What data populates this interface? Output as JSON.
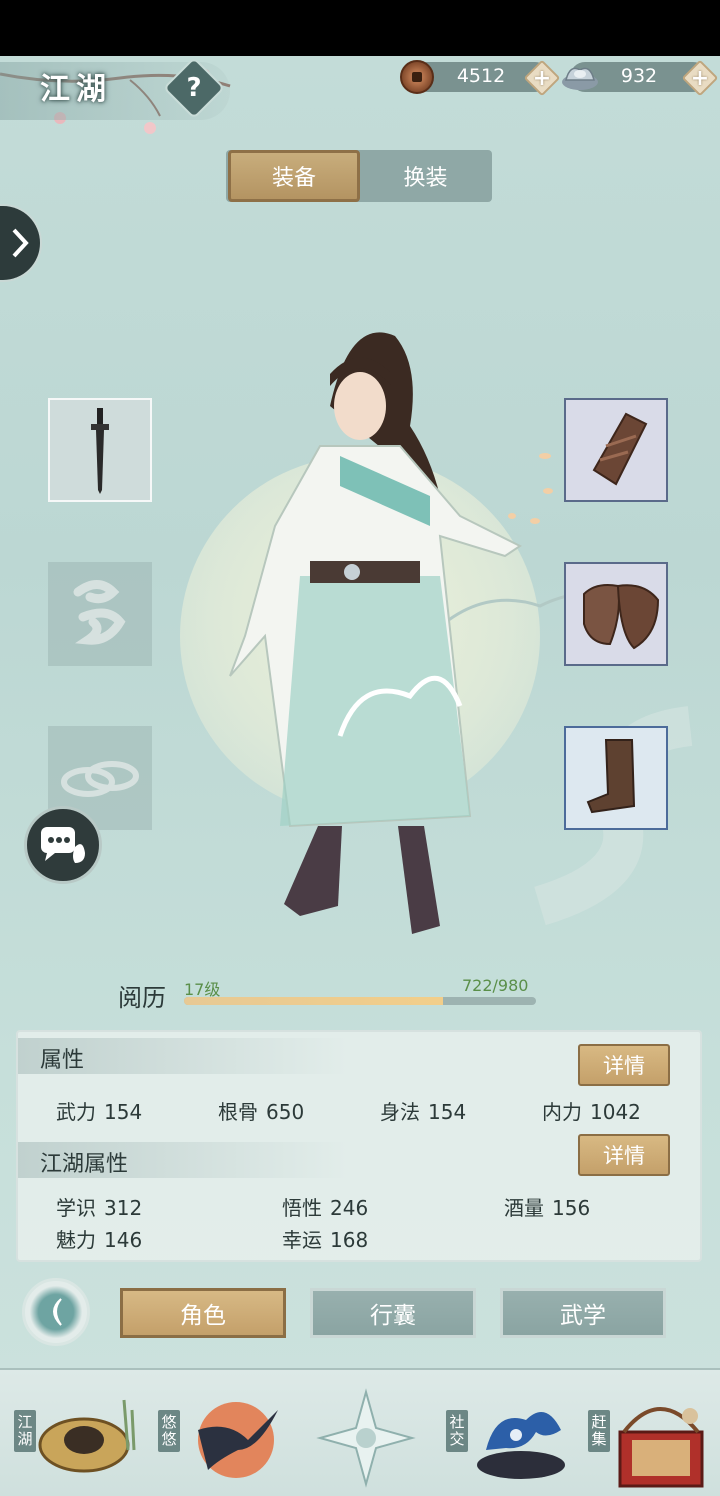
{
  "header": {
    "title": "江湖",
    "help_label": "?",
    "copper": "4512",
    "silver": "932",
    "plus_label": "+"
  },
  "tabs": [
    {
      "label": "装备",
      "active": true
    },
    {
      "label": "换装",
      "active": false
    }
  ],
  "experience": {
    "label": "阅历",
    "level": "17级",
    "progress": "722/980",
    "fraction": 0.737
  },
  "attributes": {
    "title": "属性",
    "detail_label": "详情",
    "stats": [
      {
        "name": "武力",
        "value": "154"
      },
      {
        "name": "根骨",
        "value": "650"
      },
      {
        "name": "身法",
        "value": "154"
      },
      {
        "name": "内力",
        "value": "1042"
      }
    ]
  },
  "jianghu_attributes": {
    "title": "江湖属性",
    "detail_label": "详情",
    "stats": [
      {
        "name": "学识",
        "value": "312"
      },
      {
        "name": "悟性",
        "value": "246"
      },
      {
        "name": "酒量",
        "value": "156"
      },
      {
        "name": "魅力",
        "value": "146"
      },
      {
        "name": "幸运",
        "value": "168"
      }
    ]
  },
  "bottom_nav": [
    {
      "label": "角色",
      "active": true
    },
    {
      "label": "行囊",
      "active": false
    },
    {
      "label": "武学",
      "active": false
    }
  ],
  "dock": [
    {
      "label": "江湖",
      "icon": "straw-hat-icon"
    },
    {
      "label": "悠悠",
      "icon": "swallow-icon"
    },
    {
      "label": "",
      "icon": "compass-star-icon"
    },
    {
      "label": "社交",
      "icon": "wave-icon"
    },
    {
      "label": "赶集",
      "icon": "market-basket-icon"
    }
  ],
  "equipment": {
    "left": [
      "dagger-icon",
      "cloud-motif-icon",
      "rings-icon"
    ],
    "right": [
      "bracer-icon",
      "shoulder-guard-icon",
      "boot-icon"
    ]
  }
}
